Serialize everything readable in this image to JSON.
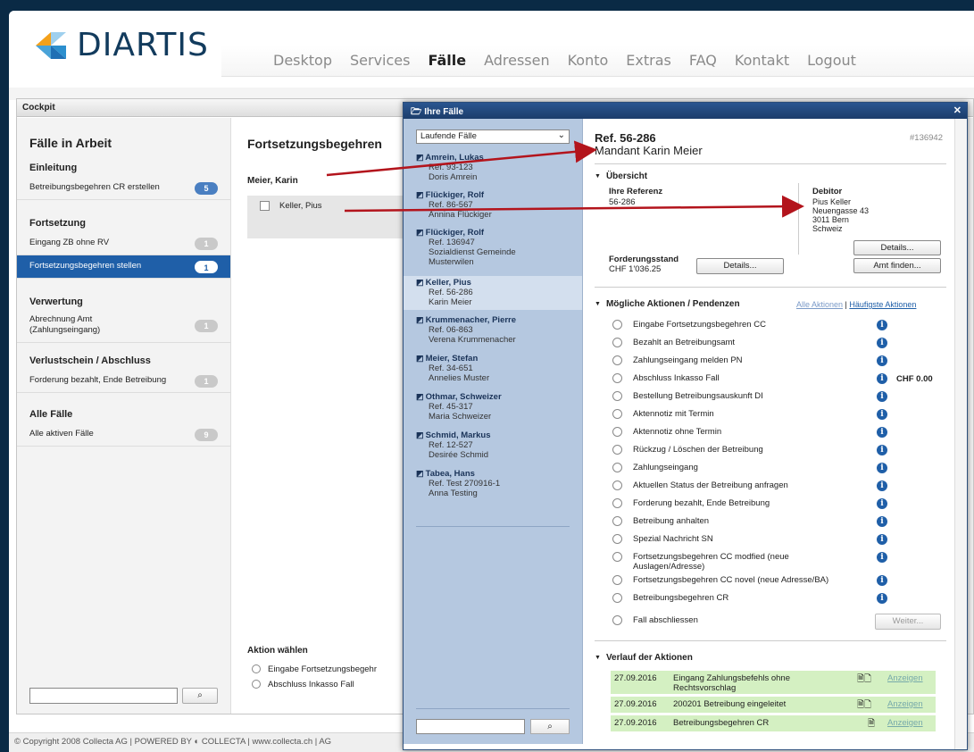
{
  "brand": {
    "name": "DIARTIS"
  },
  "nav": [
    "Desktop",
    "Services",
    "Fälle",
    "Adressen",
    "Konto",
    "Extras",
    "FAQ",
    "Kontakt",
    "Logout"
  ],
  "cockpit": {
    "title": "Cockpit",
    "sidebar": {
      "title": "Fälle in Arbeit",
      "sections": [
        {
          "title": "Einleitung",
          "items": [
            {
              "label": "Betreibungsbegehren CR erstellen",
              "count": "5"
            }
          ]
        },
        {
          "title": "Fortsetzung",
          "items": [
            {
              "label": "Eingang ZB ohne RV",
              "count": "1"
            },
            {
              "label": "Fortsetzungsbegehren stellen",
              "count": "1"
            }
          ]
        },
        {
          "title": "Verwertung",
          "items": [
            {
              "label": "Abrechnung Amt (Zahlungseingang)",
              "count": "1"
            }
          ]
        },
        {
          "title": "Verlustschein / Abschluss",
          "items": [
            {
              "label": "Forderung bezahlt, Ende Betreibung",
              "count": "1"
            }
          ]
        },
        {
          "title": "Alle Fälle",
          "items": [
            {
              "label": "Alle aktiven Fälle",
              "count": "9"
            }
          ]
        }
      ],
      "search_value": ""
    },
    "main": {
      "title": "Fortsetzungsbegehren",
      "group": "Meier, Karin",
      "row": "Keller, Pius",
      "aktion_title": "Aktion wählen",
      "aktion_options": [
        "Eingabe Fortsetzungsbegehr",
        "Abschluss Inkasso Fall"
      ]
    }
  },
  "footer": "© Copyright 2008 Collecta AG  |  POWERED BY ◐ COLLECTA  |  www.collecta.ch  |  AG",
  "dialog": {
    "title": "Ihre Fälle",
    "filter": "Laufende Fälle",
    "cases": [
      {
        "name": "Amrein, Lukas",
        "ref": "Ref. 93-123",
        "contact": "Doris Amrein"
      },
      {
        "name": "Flückiger, Rolf",
        "ref": "Ref. 86-567",
        "contact": "Annina Flückiger"
      },
      {
        "name": "Flückiger, Rolf",
        "ref": "Ref. 136947",
        "contact": "Sozialdienst Gemeinde",
        "contact2": "Musterwilen"
      },
      {
        "name": "Keller, Pius",
        "ref": "Ref. 56-286",
        "contact": "Karin Meier"
      },
      {
        "name": "Krummenacher, Pierre",
        "ref": "Ref. 06-863",
        "contact": "Verena Krummenacher"
      },
      {
        "name": "Meier, Stefan",
        "ref": "Ref. 34-651",
        "contact": "Annelies Muster"
      },
      {
        "name": "Othmar, Schweizer",
        "ref": "Ref. 45-317",
        "contact": "Maria Schweizer"
      },
      {
        "name": "Schmid, Markus",
        "ref": "Ref. 12-527",
        "contact": "Desirée Schmid"
      },
      {
        "name": "Tabea, Hans",
        "ref": "Ref. Test 270916-1",
        "contact": "Anna Testing"
      }
    ],
    "detail": {
      "ref": "Ref. 56-286",
      "mandant": "Mandant Karin Meier",
      "number": "#136942",
      "overview_title": "Übersicht",
      "ihre_ref_label": "Ihre Referenz",
      "ihre_ref": "56-286",
      "debitor_label": "Debitor",
      "debitor_lines": [
        "Pius Keller",
        "Neuengasse 43",
        "3011 Bern",
        "Schweiz"
      ],
      "forderung_label": "Forderungsstand",
      "forderung": "CHF 1'036.25",
      "details_btn": "Details...",
      "details_btn2": "Details...",
      "amt_btn": "Amt finden...",
      "actions_title": "Mögliche Aktionen / Pendenzen",
      "all_actions": "Alle Aktionen",
      "top_actions": "Häufigste Aktionen",
      "amount": "CHF  0.00",
      "actions": [
        "Eingabe Fortsetzungsbegehren CC",
        "Bezahlt an Betreibungsamt",
        "Zahlungseingang melden PN",
        "Abschluss Inkasso Fall",
        "Bestellung Betreibungsauskunft DI",
        "Aktennotiz mit Termin",
        "Aktennotiz ohne Termin",
        "Rückzug / Löschen der Betreibung",
        "Zahlungseingang",
        "Aktuellen Status der Betreibung anfragen",
        "Forderung bezahlt, Ende Betreibung",
        "Betreibung anhalten",
        "Spezial Nachricht SN",
        "Fortsetzungsbegehren CC modfied (neue",
        "Auslagen/Adresse)",
        "Fortsetzungsbegehren CC novel (neue Adresse/BA)",
        "Betreibungsbegehren CR",
        "Fall abschliessen"
      ],
      "weiter_btn": "Weiter...",
      "history_title": "Verlauf der Aktionen",
      "history": [
        {
          "date": "27.09.2016",
          "text": "Eingang Zahlungsbefehls ohne Rechtsvorschlag",
          "link": "Anzeigen"
        },
        {
          "date": "27.09.2016",
          "text": "200201 Betreibung eingeleitet",
          "link": "Anzeigen"
        },
        {
          "date": "27.09.2016",
          "text": "Betreibungsbegehren CR",
          "link": "Anzeigen"
        }
      ]
    }
  },
  "colors": {
    "header_bg": "#0a2a45",
    "active_blue": "#1f5fa8",
    "case_list_bg": "#b5c8e0",
    "history_green": "#d4f0c2",
    "arrow_red": "#b3141c"
  }
}
